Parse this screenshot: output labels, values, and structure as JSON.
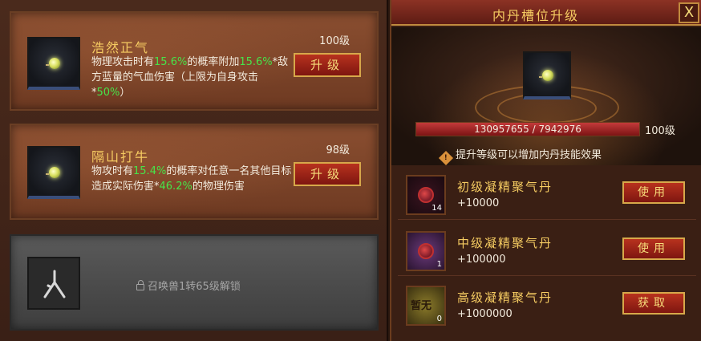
{
  "skills": [
    {
      "name": "浩然正气",
      "level": "100级",
      "desc_parts": [
        "物理攻击时有",
        "15.6%",
        "的概率附加",
        "15.6%",
        "*敌方蓝量的气血伤害（上限为自身攻击*",
        "50%",
        "）"
      ],
      "button": "升级"
    },
    {
      "name": "隔山打牛",
      "level": "98级",
      "desc_parts": [
        "物攻时有",
        "15.4%",
        "的概率对任意一名其他目标造成实际伤害*",
        "46.2%",
        "的物理伤害"
      ],
      "button": "升级"
    }
  ],
  "locked_slot": {
    "text": "召唤兽1转65级解锁",
    "icon": "lock-icon"
  },
  "panel": {
    "title": "内丹槽位升级",
    "close": "X",
    "exp_text": "130957655 / 7942976",
    "exp_fraction": 1.0,
    "level": "100级",
    "tip": "提升等级可以增加内丹技能效果",
    "items": [
      {
        "name": "初级凝精聚气丹",
        "value": "+10000",
        "count": "14",
        "button": "使用"
      },
      {
        "name": "中级凝精聚气丹",
        "value": "+100000",
        "count": "1",
        "button": "使用"
      },
      {
        "name": "高级凝精聚气丹",
        "value": "+1000000",
        "count": "0",
        "icon_text": "暂无",
        "button": "获取"
      }
    ]
  },
  "colors": {
    "accent_gold": "#f6cc62",
    "highlight_green": "#47e34a",
    "button_red": "#b8321e"
  }
}
